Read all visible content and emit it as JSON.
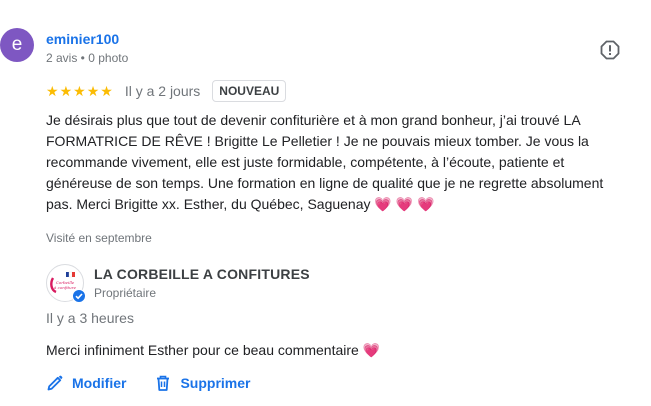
{
  "review": {
    "avatar_letter": "e",
    "avatar_color": "#7e57c2",
    "author": "eminier100",
    "author_meta": "2 avis • 0 photo",
    "rating": 5,
    "star_color": "#fbbc04",
    "date": "Il y a 2 jours",
    "badge": "NOUVEAU",
    "text": "Je désirais plus que tout de devenir confiturière et à mon grand bonheur, j’ai trouvé LA FORMATRICE DE RÊVE ! Brigitte Le Pelletier ! Je ne pouvais mieux tomber. Je vous la recommande vivement, elle est juste formidable, compétente, à l’écoute, patiente et généreuse de son temps. Une formation en ligne de qualité que je ne regrette absolument pas. Merci Brigitte xx. Esther, du Québec, Saguenay 💗 💗 💗",
    "visited": "Visité en septembre",
    "report_icon": "report-flag-icon"
  },
  "reply": {
    "owner_name": "LA CORBEILLE A CONFITURES",
    "owner_role": "Propriétaire",
    "date": "Il y a 3 heures",
    "text": "Merci infiniment Esther pour ce beau commentaire 💗",
    "verified_color": "#1a73e8"
  },
  "actions": {
    "edit_label": "Modifier",
    "edit_icon": "pencil-icon",
    "delete_label": "Supprimer",
    "delete_icon": "trash-icon"
  }
}
